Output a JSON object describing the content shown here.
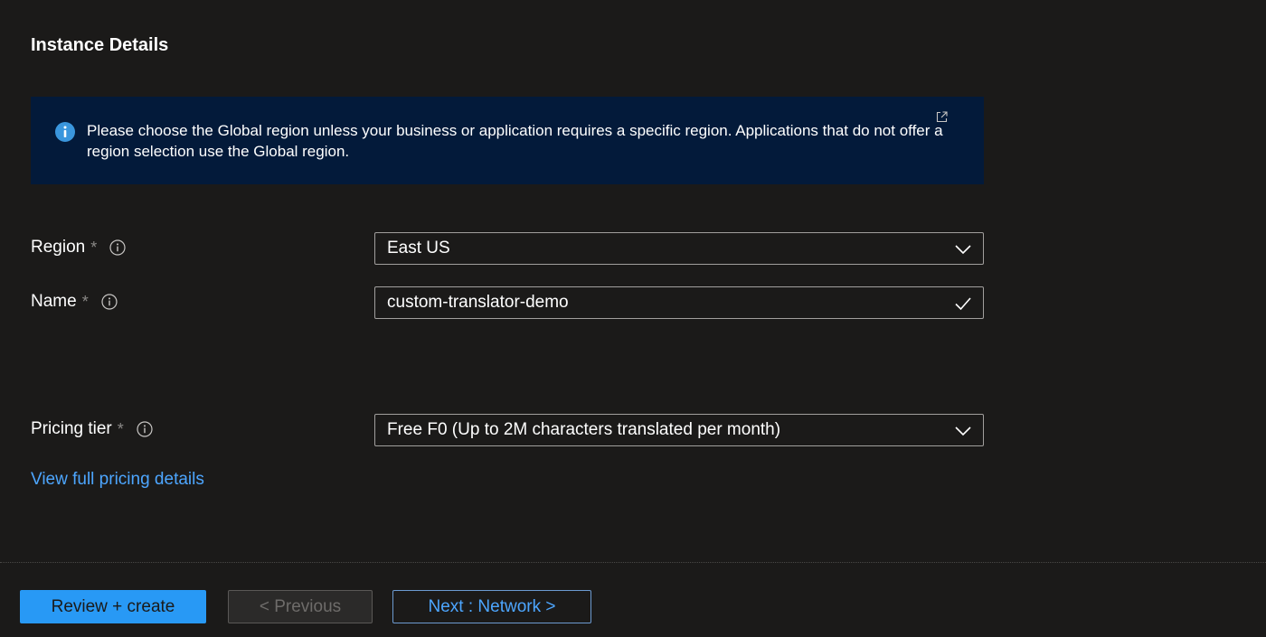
{
  "section": {
    "title": "Instance Details"
  },
  "info_banner": {
    "text": "Please choose the Global region unless your business or application requires a specific region. Applications that do not offer a region selection use the Global region."
  },
  "form": {
    "region": {
      "label": "Region",
      "required_marker": "*",
      "value": "East US"
    },
    "name": {
      "label": "Name",
      "required_marker": "*",
      "value": "custom-translator-demo"
    },
    "pricing_tier": {
      "label": "Pricing tier",
      "required_marker": "*",
      "value": "Free F0 (Up to 2M characters translated per month)"
    },
    "pricing_link": "View full pricing details"
  },
  "footer": {
    "review_create_label": "Review + create",
    "previous_label": "< Previous",
    "next_label": "Next : Network >"
  },
  "icons": {
    "info": "info-icon",
    "external_link": "external-link-icon",
    "help": "help-circle-icon",
    "chevron_down": "chevron-down-icon",
    "checkmark": "checkmark-icon"
  },
  "colors": {
    "background": "#1b1a19",
    "banner_background": "#031a3a",
    "accent": "#2899f5",
    "link": "#4da6ff",
    "field_border": "#a19f9d"
  }
}
